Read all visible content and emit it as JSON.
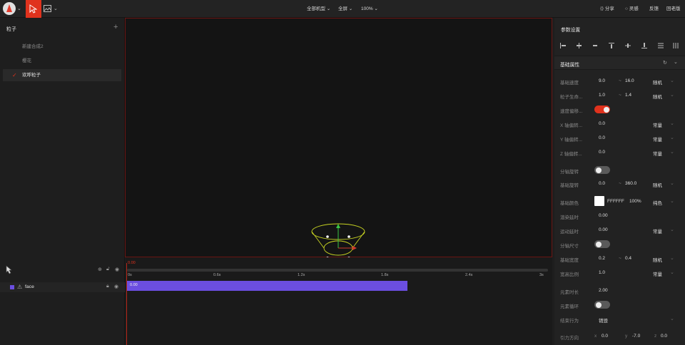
{
  "toolbar": {
    "device_label": "全部机型",
    "fullscreen_label": "全屏",
    "zoom_label": "100%",
    "share_label": "分享",
    "inspiration_label": "灵感",
    "feedback_label": "反馈",
    "old_version_label": "回老版",
    "accent": "#e0321d"
  },
  "left_panel": {
    "title": "粒子",
    "items": [
      {
        "label": "新建合成2",
        "selected": false
      },
      {
        "label": "樱花",
        "selected": false
      },
      {
        "label": "欢呼粒子",
        "selected": true
      }
    ]
  },
  "timeline": {
    "current_time": "0.00",
    "ticks": [
      "0s",
      "0.6s",
      "1.2s",
      "1.8s",
      "2.4s",
      "3s"
    ],
    "layer_name": "face",
    "track_start": "0.00",
    "track_color": "#6b4ee0"
  },
  "right_panel": {
    "title": "参数设置",
    "section_title": "基础属性",
    "rows": [
      {
        "label": "基础速度",
        "v1": "9.0",
        "v2": "16.0",
        "mode": "随机"
      },
      {
        "label": "粒子生命...",
        "v1": "1.0",
        "v2": "1.4",
        "mode": "随机"
      },
      {
        "label": "速度偏移..."
      },
      {
        "label": "X 轴偏转...",
        "v1": "0.0",
        "mode": "常量"
      },
      {
        "label": "Y 轴偏转...",
        "v1": "0.0",
        "mode": "常量"
      },
      {
        "label": "Z 轴偏转...",
        "v1": "0.0",
        "mode": "常量"
      },
      {
        "label": "分轴旋转"
      },
      {
        "label": "基础旋转",
        "v1": "0.0",
        "v2": "360.0",
        "mode": "随机"
      },
      {
        "label": "基础颜色",
        "hex": "FFFFFF",
        "opacity": "100%",
        "mode": "纯色"
      },
      {
        "label": "渲染延时",
        "v1": "0.00"
      },
      {
        "label": "运动延时",
        "v1": "0.00",
        "mode": "常量"
      },
      {
        "label": "分轴尺寸"
      },
      {
        "label": "基础宽度",
        "v1": "0.2",
        "v2": "0.4",
        "mode": "随机"
      },
      {
        "label": "宽高比例",
        "v1": "1.0",
        "mode": "常量"
      },
      {
        "label": "元素时长",
        "v1": "2.00"
      },
      {
        "label": "元素循环"
      },
      {
        "label": "结束行为",
        "v1": "销毁"
      },
      {
        "label": "引力方向",
        "gx": "0.0",
        "gy": "-7.0",
        "gz": "0.0"
      }
    ],
    "toggles": {
      "speed_offset": true,
      "axis_rotate": false,
      "axis_size": false,
      "loop": false
    }
  }
}
